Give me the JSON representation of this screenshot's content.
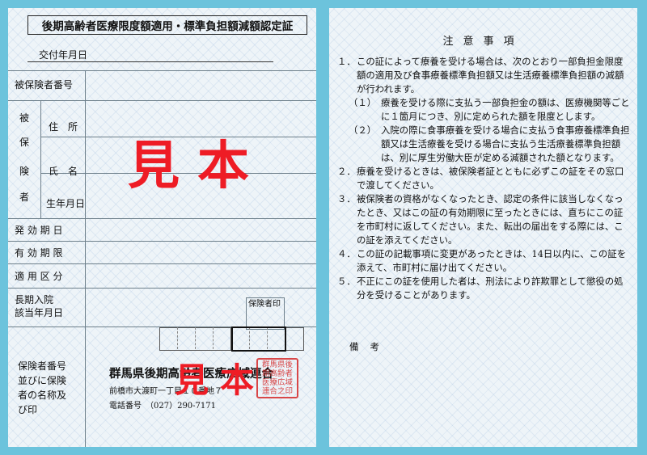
{
  "left": {
    "title": "後期高齢者医療限度額適用・標準負担額減額認定証",
    "issue_date_label": "交付年月日",
    "rows": {
      "insured_number": "被保険者番号",
      "insured_vertical": [
        "被",
        "保",
        "険",
        "者"
      ],
      "address": "住　所",
      "name": "氏　名",
      "birthdate": "生年月日",
      "effective_from": "発 効 期 日",
      "valid_until": "有 効 期 限",
      "category": "適 用 区 分",
      "long_term_line1": "長期入院",
      "long_term_line2": "該当年月日",
      "insurer_seal_label": "保険者印",
      "insurer_label": [
        "保険者番号",
        "並びに保険",
        "者の名称及",
        "び印"
      ]
    },
    "sample_mark": "見本",
    "insurer": {
      "name": "群馬県後期高齢者医療広域連合",
      "address": "前橋市大渡町一丁目１０番地７",
      "tel": "電話番号　（027）290-7171",
      "seal": "群馬県後期高齢者医療広域連合之印"
    }
  },
  "right": {
    "title": "注意事項",
    "notes": [
      {
        "n": "１．",
        "t": "この証によって療養を受ける場合は、次のとおり一部負担金限度額の適用及び食事療養標準負担額又は生活療養標準負担額の減額が行われます。"
      },
      {
        "n": "（１）",
        "t": "療養を受ける際に支払う一部負担金の額は、医療機関等ごとに１箇月につき、別に定められた額を限度とします。"
      },
      {
        "n": "（２）",
        "t": "入院の際に食事療養を受ける場合に支払う食事療養標準負担額又は生活療養を受ける場合に支払う生活療養標準負担額は、別に厚生労働大臣が定める減額された額となります。"
      },
      {
        "n": "２．",
        "t": "療養を受けるときは、被保険者証とともに必ずこの証をその窓口で渡してください。"
      },
      {
        "n": "３．",
        "t": "被保険者の資格がなくなったとき、認定の条件に該当しなくなったとき、又はこの証の有効期限に至ったときには、直ちにこの証を市町村に返してください。また、転出の届出をする際には、この証を添えてください。"
      },
      {
        "n": "４．",
        "t": "この証の記載事項に変更があったときは、14日以内に、この証を添えて、市町村に届け出てください。"
      },
      {
        "n": "５．",
        "t": "不正にこの証を使用した者は、刑法により詐欺罪として懲役の処分を受けることがあります。"
      }
    ],
    "remarks_label": "備考"
  }
}
